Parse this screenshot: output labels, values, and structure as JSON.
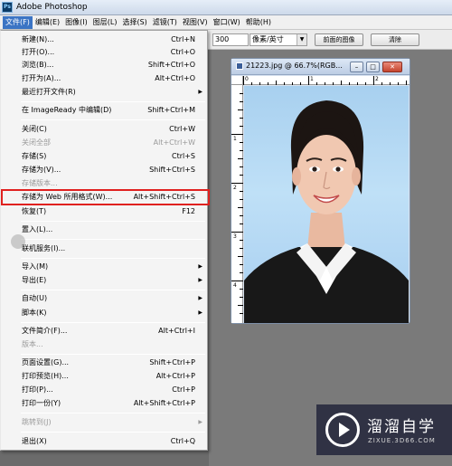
{
  "app": {
    "title": "Adobe Photoshop"
  },
  "menubar": [
    "文件(F)",
    "编辑(E)",
    "图像(I)",
    "图层(L)",
    "选择(S)",
    "滤镜(T)",
    "视图(V)",
    "窗口(W)",
    "帮助(H)"
  ],
  "options": {
    "resolution": "300",
    "unit": "像素/英寸",
    "front_image_label": "前面的图像",
    "clear_label": "清除"
  },
  "file_menu": {
    "items": [
      {
        "label": "新建(N)...",
        "shortcut": "Ctrl+N"
      },
      {
        "label": "打开(O)...",
        "shortcut": "Ctrl+O"
      },
      {
        "label": "浏览(B)...",
        "shortcut": "Shift+Ctrl+O"
      },
      {
        "label": "打开为(A)...",
        "shortcut": "Alt+Ctrl+O"
      },
      {
        "label": "最近打开文件(R)",
        "shortcut": ""
      },
      {
        "label": "在 ImageReady 中编辑(D)",
        "shortcut": "Shift+Ctrl+M"
      },
      {
        "label": "关闭(C)",
        "shortcut": "Ctrl+W"
      },
      {
        "label": "关闭全部",
        "shortcut": "Alt+Ctrl+W"
      },
      {
        "label": "存储(S)",
        "shortcut": "Ctrl+S"
      },
      {
        "label": "存储为(V)...",
        "shortcut": "Shift+Ctrl+S"
      },
      {
        "label": "存储版本...",
        "shortcut": ""
      },
      {
        "label": "存储为 Web 所用格式(W)...",
        "shortcut": "Alt+Shift+Ctrl+S"
      },
      {
        "label": "恢复(T)",
        "shortcut": "F12"
      },
      {
        "label": "置入(L)...",
        "shortcut": ""
      },
      {
        "label": "联机服务(I)...",
        "shortcut": ""
      },
      {
        "label": "导入(M)",
        "shortcut": ""
      },
      {
        "label": "导出(E)",
        "shortcut": ""
      },
      {
        "label": "自动(U)",
        "shortcut": ""
      },
      {
        "label": "脚本(K)",
        "shortcut": ""
      },
      {
        "label": "文件简介(F)...",
        "shortcut": "Alt+Ctrl+I"
      },
      {
        "label": "版本...",
        "shortcut": ""
      },
      {
        "label": "页面设置(G)...",
        "shortcut": "Shift+Ctrl+P"
      },
      {
        "label": "打印预览(H)...",
        "shortcut": "Alt+Ctrl+P"
      },
      {
        "label": "打印(P)...",
        "shortcut": "Ctrl+P"
      },
      {
        "label": "打印一份(Y)",
        "shortcut": "Alt+Shift+Ctrl+P"
      },
      {
        "label": "跳转到(J)",
        "shortcut": ""
      },
      {
        "label": "退出(X)",
        "shortcut": "Ctrl+Q"
      }
    ]
  },
  "document": {
    "title": "21223.jpg @ 66.7%(RGB...",
    "ruler_top": [
      "0",
      "1",
      "2"
    ],
    "ruler_left": [
      "1",
      "2",
      "3",
      "4"
    ]
  },
  "watermark": {
    "brand": "溜溜自学",
    "url": "ZIXUE.3D66.COM"
  },
  "colors": {
    "highlight_border": "#e0211f",
    "menu_active": "#3b74c4",
    "watermark_bg": "#26283c"
  }
}
